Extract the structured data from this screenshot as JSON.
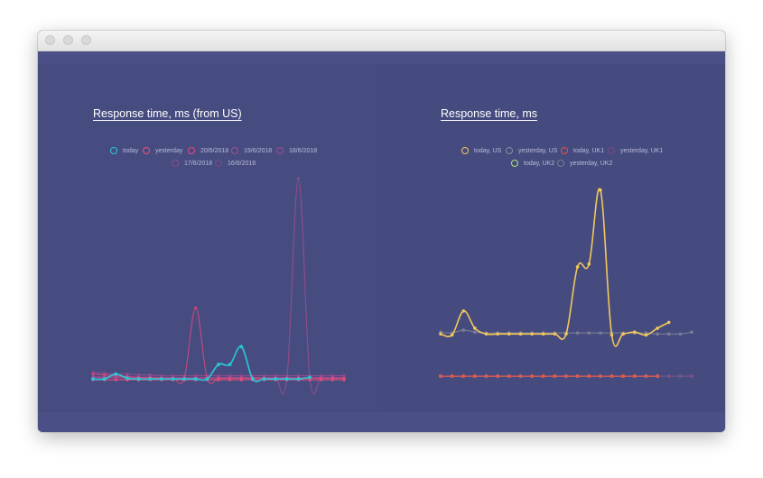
{
  "window": {
    "traffic_lights": [
      "close-icon",
      "minimize-icon",
      "zoom-icon"
    ]
  },
  "charts": {
    "left": {
      "title": "Response time, ms (from US)"
    },
    "right": {
      "title": "Response time, ms"
    }
  },
  "chart_data": [
    {
      "type": "line",
      "title": "Response time, ms (from US)",
      "xlabel": "",
      "ylabel": "",
      "grid": false,
      "legend_position": "top",
      "x": [
        1,
        2,
        3,
        4,
        5,
        6,
        7,
        8,
        9,
        10,
        11,
        12,
        13,
        14,
        15,
        16,
        17,
        18,
        19,
        20,
        21,
        22,
        23
      ],
      "ylim": [
        0,
        250
      ],
      "series": [
        {
          "name": "today",
          "color": "#29c8d8",
          "values": [
            2,
            2,
            8,
            3,
            2,
            2,
            2,
            2,
            2,
            2,
            2,
            20,
            20,
            42,
            2,
            2,
            2,
            2,
            2,
            4,
            null,
            null,
            null
          ]
        },
        {
          "name": "yesterday",
          "color": "#e9507a",
          "values": [
            1,
            1,
            1,
            1,
            1,
            1,
            1,
            1,
            1,
            1,
            1,
            1,
            1,
            1,
            1,
            1,
            1,
            1,
            1,
            1,
            1,
            1,
            1
          ]
        },
        {
          "name": "20/6/2018",
          "color": "#e6477e",
          "values": [
            8,
            7,
            6,
            5,
            4,
            4,
            3,
            3,
            3,
            90,
            3,
            3,
            3,
            3,
            3,
            3,
            3,
            3,
            3,
            3,
            3,
            3,
            3
          ]
        },
        {
          "name": "19/6/2018",
          "color": "#a14f8e",
          "values": [
            4,
            4,
            4,
            4,
            3,
            3,
            3,
            3,
            3,
            3,
            3,
            3,
            3,
            3,
            3,
            3,
            3,
            3,
            250,
            3,
            3,
            3,
            3
          ]
        },
        {
          "name": "18/6/2018",
          "color": "#a04a90",
          "values": [
            10,
            9,
            8,
            8,
            7,
            7,
            6,
            6,
            6,
            6,
            6,
            6,
            6,
            6,
            6,
            6,
            6,
            6,
            6,
            6,
            6,
            6,
            6
          ]
        },
        {
          "name": "17/6/2018",
          "color": "#8e4a8c",
          "values": [
            5,
            5,
            5,
            5,
            4,
            4,
            4,
            4,
            4,
            4,
            4,
            4,
            4,
            4,
            4,
            4,
            4,
            4,
            4,
            4,
            4,
            4,
            4
          ]
        },
        {
          "name": "16/6/2018",
          "color": "#7d4a8a",
          "values": [
            3,
            3,
            3,
            3,
            3,
            3,
            3,
            3,
            3,
            3,
            3,
            3,
            3,
            3,
            3,
            3,
            3,
            3,
            3,
            3,
            3,
            3,
            3
          ]
        }
      ]
    },
    {
      "type": "line",
      "title": "Response time, ms",
      "xlabel": "",
      "ylabel": "",
      "grid": false,
      "legend_position": "top",
      "x": [
        1,
        2,
        3,
        4,
        5,
        6,
        7,
        8,
        9,
        10,
        11,
        12,
        13,
        14,
        15,
        16,
        17,
        18,
        19,
        20,
        21,
        22,
        23
      ],
      "ylim": [
        0,
        220
      ],
      "series": [
        {
          "name": "today, US",
          "color": "#f1c85a",
          "values": [
            58,
            57,
            82,
            64,
            58,
            58,
            58,
            58,
            58,
            58,
            58,
            58,
            128,
            131,
            208,
            57,
            58,
            60,
            57,
            64,
            70,
            null,
            null
          ]
        },
        {
          "name": "yesterday, US",
          "color": "#8d8e9e",
          "values": [
            60,
            59,
            62,
            60,
            59,
            59,
            59,
            59,
            59,
            59,
            59,
            59,
            59,
            59,
            59,
            59,
            59,
            59,
            59,
            58,
            58,
            58,
            60
          ]
        },
        {
          "name": "today, UK1",
          "color": "#e4534b",
          "values": [
            14,
            14,
            14,
            14,
            14,
            14,
            14,
            14,
            14,
            14,
            14,
            14,
            14,
            14,
            14,
            14,
            14,
            14,
            14,
            14,
            null,
            null,
            null
          ]
        },
        {
          "name": "yesterday, UK1",
          "color": "#7b4a88",
          "values": [
            14,
            14,
            14,
            14,
            14,
            14,
            14,
            14,
            14,
            14,
            14,
            14,
            14,
            14,
            14,
            14,
            14,
            14,
            14,
            14,
            14,
            14,
            14
          ]
        },
        {
          "name": "today, UK2",
          "color": "#b3e07a",
          "values": [
            14,
            14,
            14,
            14,
            14,
            14,
            14,
            14,
            14,
            14,
            14,
            14,
            14,
            14,
            14,
            14,
            14,
            14,
            14,
            14,
            null,
            null,
            null
          ]
        },
        {
          "name": "yesterday, UK2",
          "color": "#7a7d8e",
          "values": [
            14,
            14,
            14,
            14,
            14,
            14,
            14,
            14,
            14,
            14,
            14,
            14,
            14,
            14,
            14,
            14,
            14,
            14,
            14,
            14,
            14,
            14,
            14
          ]
        }
      ]
    }
  ]
}
